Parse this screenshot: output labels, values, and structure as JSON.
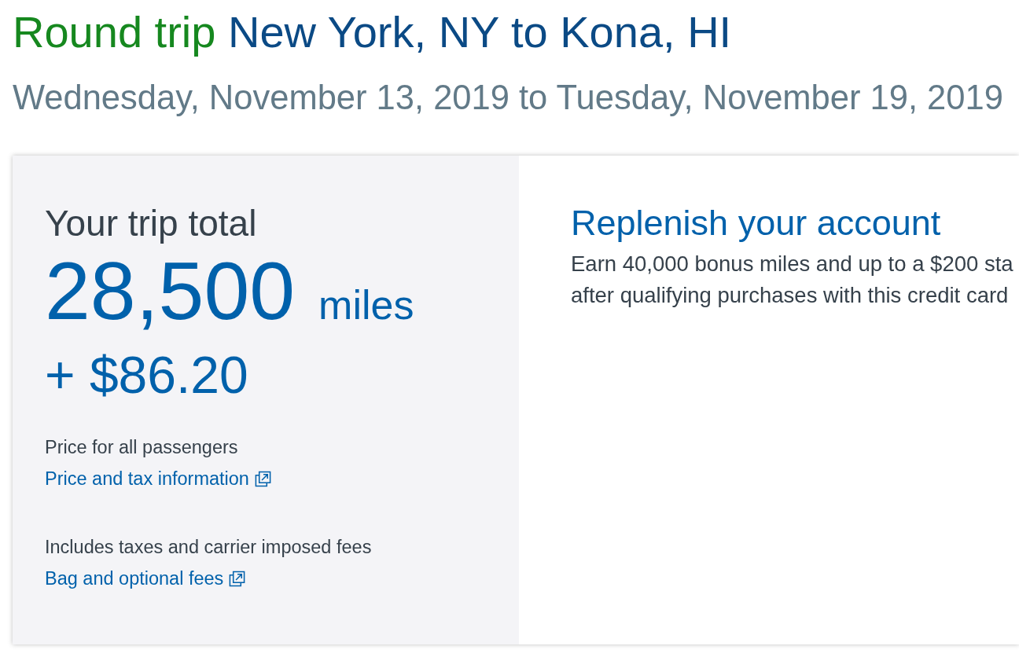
{
  "heading": {
    "trip_type": "Round trip",
    "route": "New York, NY to Kona, HI"
  },
  "dates": "Wednesday, November 13, 2019 to Tuesday, November 19, 2019",
  "trip_total": {
    "title": "Your trip total",
    "miles": "28,500",
    "miles_unit": "miles",
    "cash": "+ $86.20",
    "price_note": "Price for all passengers",
    "price_link": "Price and tax information",
    "fees_note": "Includes taxes and carrier imposed fees",
    "fees_link": "Bag and optional fees"
  },
  "promo": {
    "title": "Replenish your account",
    "description_lines": [
      "Earn 40,000 bonus miles and up to a $200 sta",
      "after qualifying purchases with this credit card"
    ]
  }
}
